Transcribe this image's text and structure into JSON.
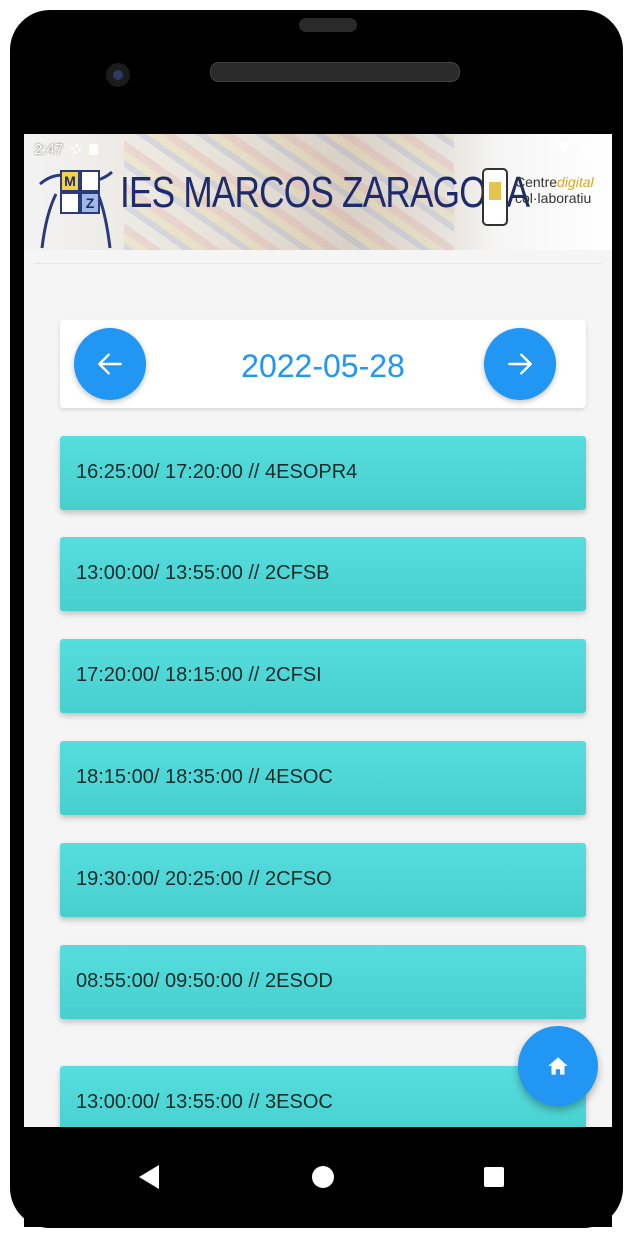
{
  "status_bar": {
    "time": "2:47"
  },
  "header": {
    "logo_letters": [
      "M",
      "Z"
    ],
    "school_name": "IES MARCOS ZARAGOZA",
    "centre_line1_a": "Centre",
    "centre_line1_b": "digital",
    "centre_line2": "col·laboratiu"
  },
  "date_nav": {
    "date": "2022-05-28",
    "prev_icon": "arrow-left-icon",
    "next_icon": "arrow-right-icon",
    "accent_color": "#2196f3"
  },
  "sessions": [
    {
      "label": "16:25:00/ 17:20:00 // 4ESOPR4"
    },
    {
      "label": "13:00:00/ 13:55:00 // 2CFSB"
    },
    {
      "label": "17:20:00/ 18:15:00 // 2CFSI"
    },
    {
      "label": "18:15:00/ 18:35:00 // 4ESOC"
    },
    {
      "label": "19:30:00/ 20:25:00 // 2CFSO"
    },
    {
      "label": "08:55:00/ 09:50:00 // 2ESOD"
    },
    {
      "label": "13:00:00/ 13:55:00 // 3ESOC"
    }
  ],
  "fab": {
    "icon": "home-icon"
  },
  "colors": {
    "row_bg": "#4dd5d4",
    "accent": "#2196f3"
  }
}
